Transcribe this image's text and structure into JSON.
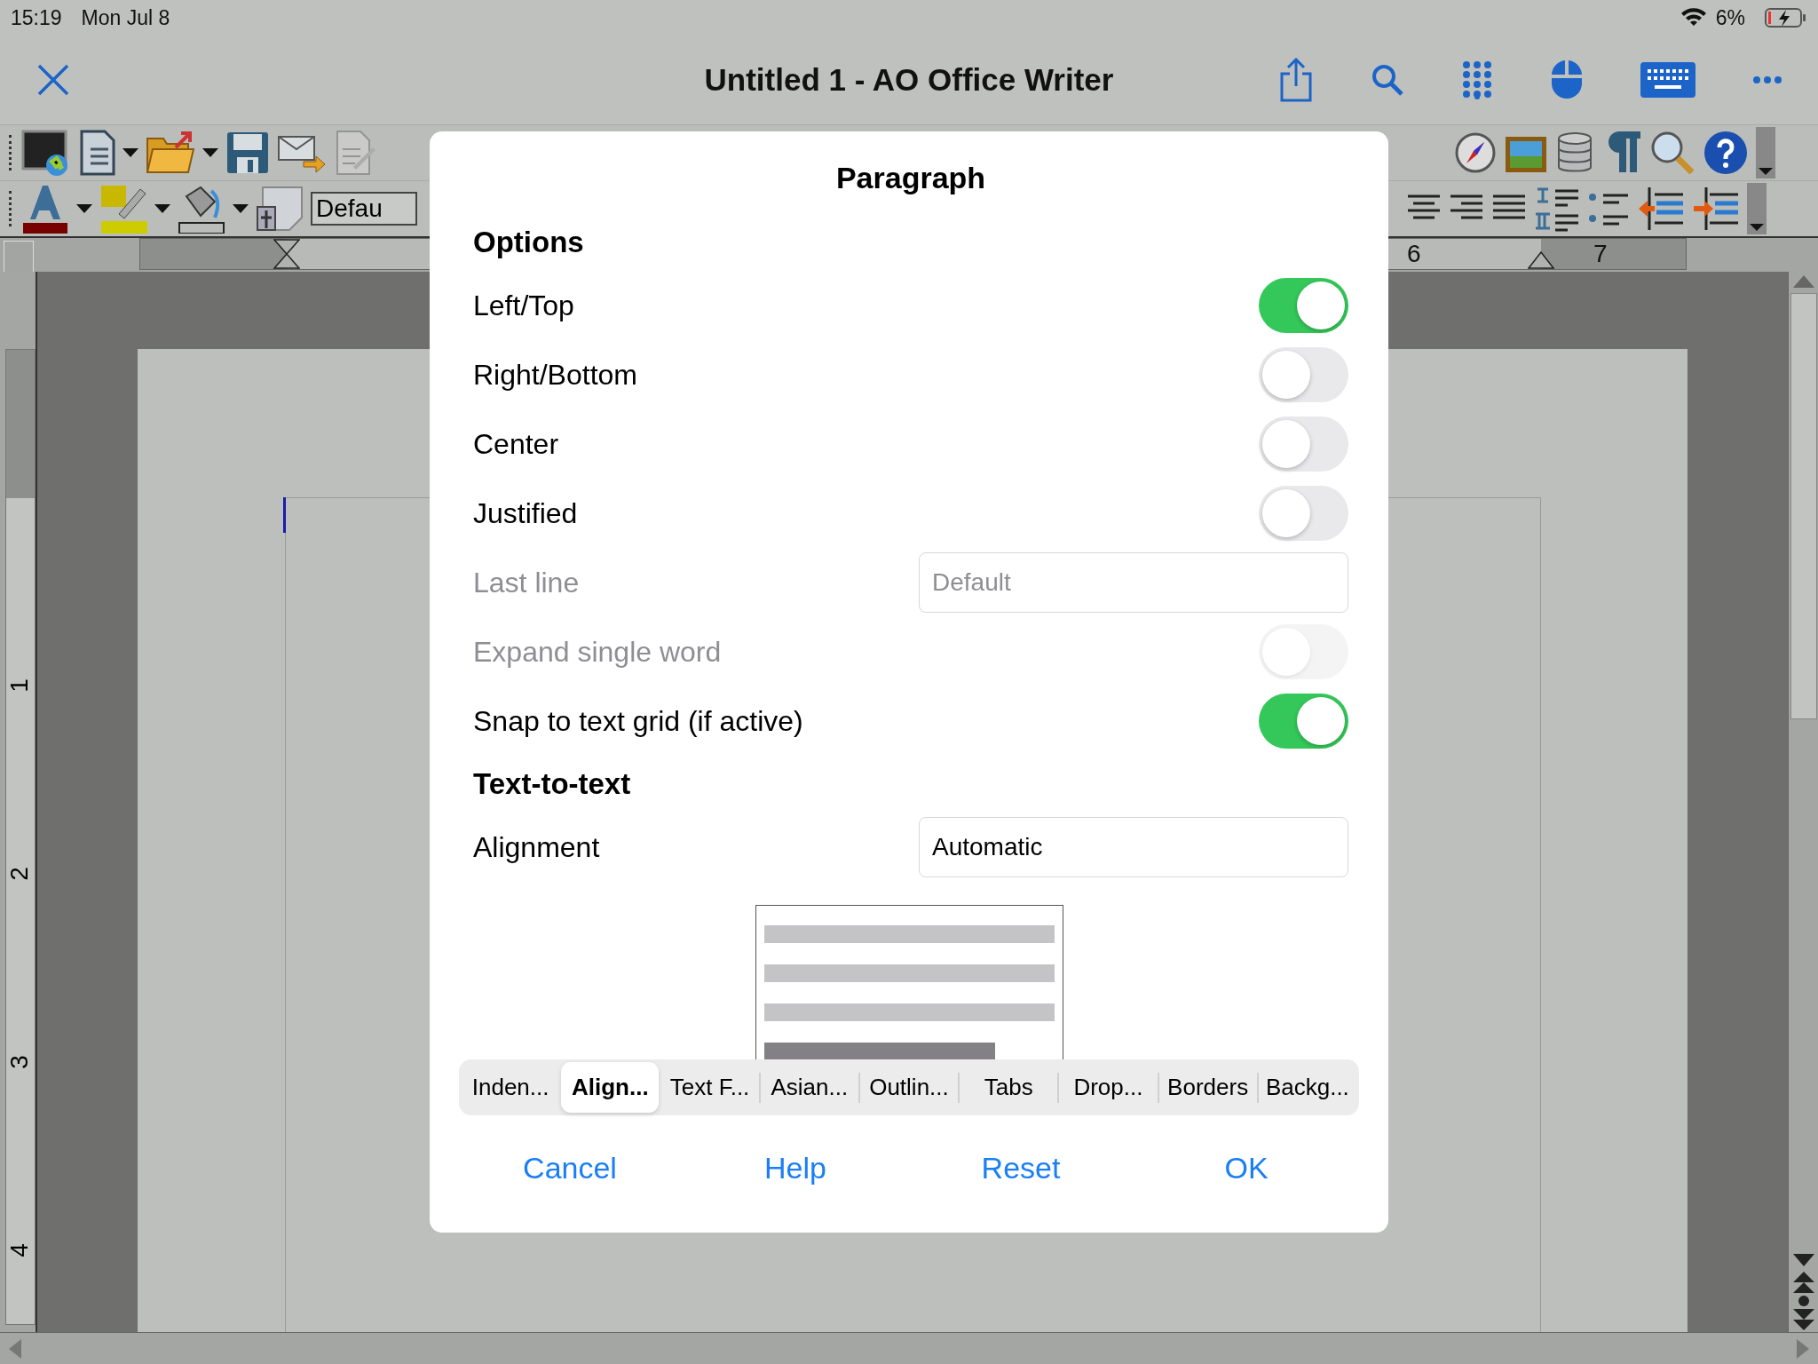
{
  "status_bar": {
    "time": "15:19",
    "date": "Mon Jul 8",
    "battery": "6%"
  },
  "nav_bar": {
    "title": "Untitled 1 - AO Office Writer"
  },
  "toolbar": {
    "style_box": "Defau"
  },
  "ruler": {
    "numbers": [
      "6",
      "7"
    ]
  },
  "vertical_ruler": {
    "numbers": [
      "1",
      "2",
      "3",
      "4"
    ]
  },
  "dialog": {
    "title": "Paragraph",
    "sections": [
      {
        "heading": "Options",
        "rows": [
          {
            "kind": "toggle",
            "label": "Left/Top",
            "on": true,
            "disabled": false
          },
          {
            "kind": "toggle",
            "label": "Right/Bottom",
            "on": false,
            "disabled": false
          },
          {
            "kind": "toggle",
            "label": "Center",
            "on": false,
            "disabled": false
          },
          {
            "kind": "toggle",
            "label": "Justified",
            "on": false,
            "disabled": false
          },
          {
            "kind": "select",
            "label": "Last line",
            "value": "Default",
            "disabled": true
          },
          {
            "kind": "toggle",
            "label": "Expand single word",
            "on": false,
            "disabled": true
          },
          {
            "kind": "toggle",
            "label": "Snap to text grid (if active)",
            "on": true,
            "disabled": false
          }
        ]
      },
      {
        "heading": "Text-to-text",
        "rows": [
          {
            "kind": "select",
            "label": "Alignment",
            "value": "Automatic",
            "disabled": false
          }
        ]
      }
    ],
    "tabs": [
      {
        "label": "Inden...",
        "selected": false
      },
      {
        "label": "Align...",
        "selected": true
      },
      {
        "label": "Text F...",
        "selected": false
      },
      {
        "label": "Asian...",
        "selected": false
      },
      {
        "label": "Outlin...",
        "selected": false
      },
      {
        "label": "Tabs",
        "selected": false
      },
      {
        "label": "Drop...",
        "selected": false
      },
      {
        "label": "Borders",
        "selected": false
      },
      {
        "label": "Backg...",
        "selected": false
      }
    ],
    "buttons": [
      "Cancel",
      "Help",
      "Reset",
      "OK"
    ]
  }
}
